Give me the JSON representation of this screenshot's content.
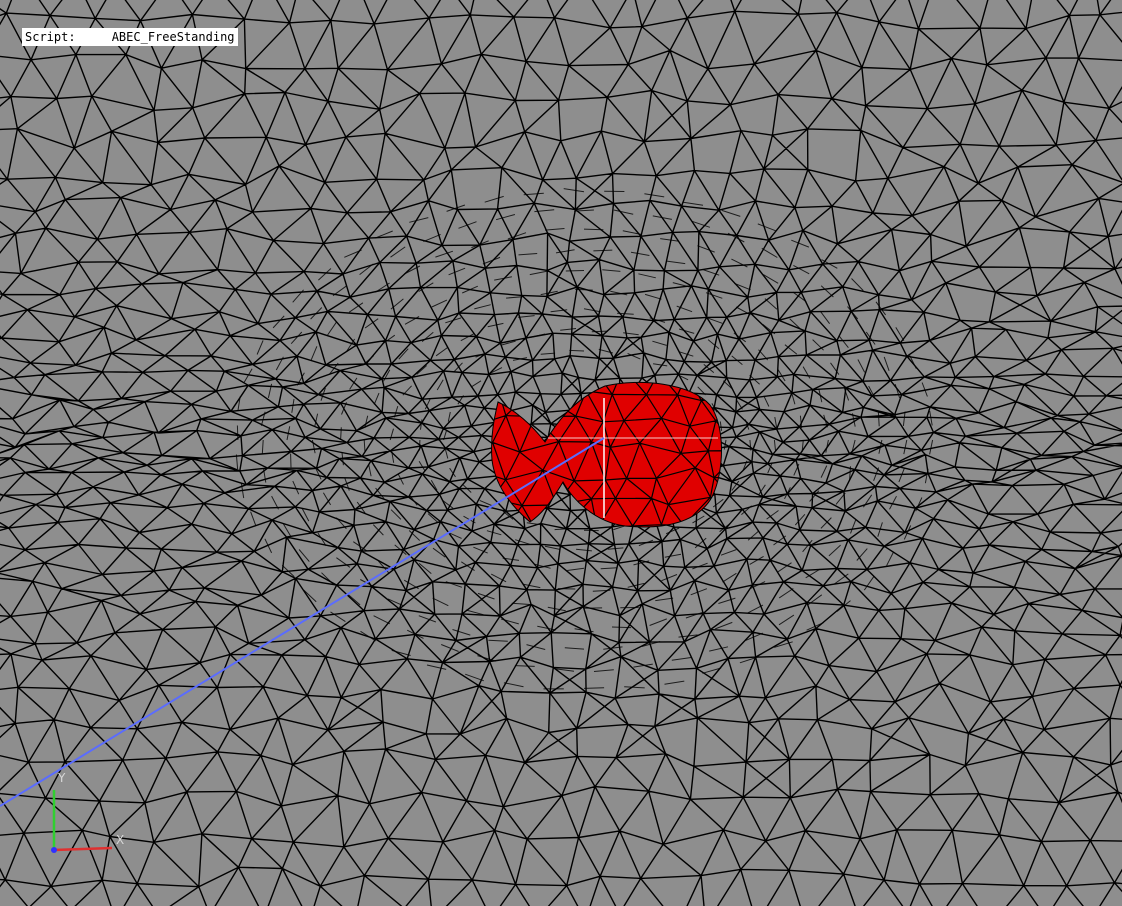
{
  "script_label": {
    "prefix": "Script:",
    "name": "ABEC_FreeStanding"
  },
  "axis_triad": {
    "y_label": "Y",
    "x_label": "X"
  },
  "colors": {
    "background": "#8e8e8e",
    "mesh_lines": "#000000",
    "driver_surface": "#e00000",
    "probe_line": "#5a6cff",
    "axis_x": "#e03030",
    "axis_y": "#30d030",
    "axis_z": "#3030ff",
    "crosshair": "#ffffff"
  },
  "icons": {
    "axis_triad": "xyz-axis-triad-icon"
  }
}
